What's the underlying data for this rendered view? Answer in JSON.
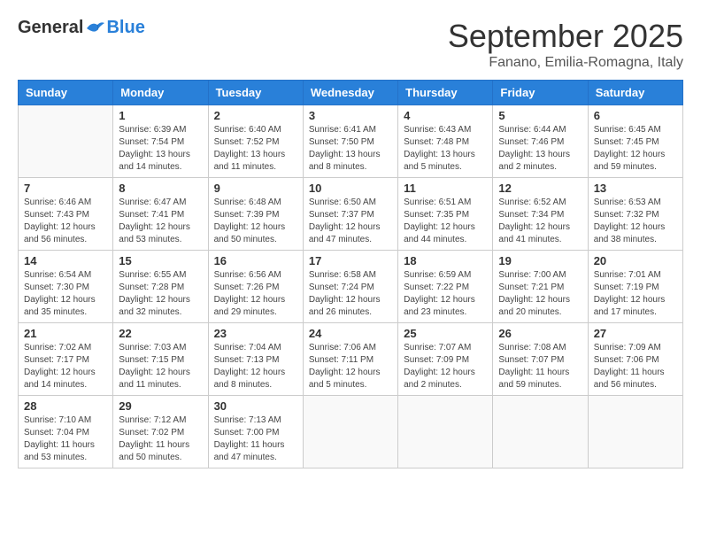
{
  "header": {
    "logo_general": "General",
    "logo_blue": "Blue",
    "month_title": "September 2025",
    "location": "Fanano, Emilia-Romagna, Italy"
  },
  "days_of_week": [
    "Sunday",
    "Monday",
    "Tuesday",
    "Wednesday",
    "Thursday",
    "Friday",
    "Saturday"
  ],
  "weeks": [
    [
      {
        "day": "",
        "info": ""
      },
      {
        "day": "1",
        "info": "Sunrise: 6:39 AM\nSunset: 7:54 PM\nDaylight: 13 hours\nand 14 minutes."
      },
      {
        "day": "2",
        "info": "Sunrise: 6:40 AM\nSunset: 7:52 PM\nDaylight: 13 hours\nand 11 minutes."
      },
      {
        "day": "3",
        "info": "Sunrise: 6:41 AM\nSunset: 7:50 PM\nDaylight: 13 hours\nand 8 minutes."
      },
      {
        "day": "4",
        "info": "Sunrise: 6:43 AM\nSunset: 7:48 PM\nDaylight: 13 hours\nand 5 minutes."
      },
      {
        "day": "5",
        "info": "Sunrise: 6:44 AM\nSunset: 7:46 PM\nDaylight: 13 hours\nand 2 minutes."
      },
      {
        "day": "6",
        "info": "Sunrise: 6:45 AM\nSunset: 7:45 PM\nDaylight: 12 hours\nand 59 minutes."
      }
    ],
    [
      {
        "day": "7",
        "info": "Sunrise: 6:46 AM\nSunset: 7:43 PM\nDaylight: 12 hours\nand 56 minutes."
      },
      {
        "day": "8",
        "info": "Sunrise: 6:47 AM\nSunset: 7:41 PM\nDaylight: 12 hours\nand 53 minutes."
      },
      {
        "day": "9",
        "info": "Sunrise: 6:48 AM\nSunset: 7:39 PM\nDaylight: 12 hours\nand 50 minutes."
      },
      {
        "day": "10",
        "info": "Sunrise: 6:50 AM\nSunset: 7:37 PM\nDaylight: 12 hours\nand 47 minutes."
      },
      {
        "day": "11",
        "info": "Sunrise: 6:51 AM\nSunset: 7:35 PM\nDaylight: 12 hours\nand 44 minutes."
      },
      {
        "day": "12",
        "info": "Sunrise: 6:52 AM\nSunset: 7:34 PM\nDaylight: 12 hours\nand 41 minutes."
      },
      {
        "day": "13",
        "info": "Sunrise: 6:53 AM\nSunset: 7:32 PM\nDaylight: 12 hours\nand 38 minutes."
      }
    ],
    [
      {
        "day": "14",
        "info": "Sunrise: 6:54 AM\nSunset: 7:30 PM\nDaylight: 12 hours\nand 35 minutes."
      },
      {
        "day": "15",
        "info": "Sunrise: 6:55 AM\nSunset: 7:28 PM\nDaylight: 12 hours\nand 32 minutes."
      },
      {
        "day": "16",
        "info": "Sunrise: 6:56 AM\nSunset: 7:26 PM\nDaylight: 12 hours\nand 29 minutes."
      },
      {
        "day": "17",
        "info": "Sunrise: 6:58 AM\nSunset: 7:24 PM\nDaylight: 12 hours\nand 26 minutes."
      },
      {
        "day": "18",
        "info": "Sunrise: 6:59 AM\nSunset: 7:22 PM\nDaylight: 12 hours\nand 23 minutes."
      },
      {
        "day": "19",
        "info": "Sunrise: 7:00 AM\nSunset: 7:21 PM\nDaylight: 12 hours\nand 20 minutes."
      },
      {
        "day": "20",
        "info": "Sunrise: 7:01 AM\nSunset: 7:19 PM\nDaylight: 12 hours\nand 17 minutes."
      }
    ],
    [
      {
        "day": "21",
        "info": "Sunrise: 7:02 AM\nSunset: 7:17 PM\nDaylight: 12 hours\nand 14 minutes."
      },
      {
        "day": "22",
        "info": "Sunrise: 7:03 AM\nSunset: 7:15 PM\nDaylight: 12 hours\nand 11 minutes."
      },
      {
        "day": "23",
        "info": "Sunrise: 7:04 AM\nSunset: 7:13 PM\nDaylight: 12 hours\nand 8 minutes."
      },
      {
        "day": "24",
        "info": "Sunrise: 7:06 AM\nSunset: 7:11 PM\nDaylight: 12 hours\nand 5 minutes."
      },
      {
        "day": "25",
        "info": "Sunrise: 7:07 AM\nSunset: 7:09 PM\nDaylight: 12 hours\nand 2 minutes."
      },
      {
        "day": "26",
        "info": "Sunrise: 7:08 AM\nSunset: 7:07 PM\nDaylight: 11 hours\nand 59 minutes."
      },
      {
        "day": "27",
        "info": "Sunrise: 7:09 AM\nSunset: 7:06 PM\nDaylight: 11 hours\nand 56 minutes."
      }
    ],
    [
      {
        "day": "28",
        "info": "Sunrise: 7:10 AM\nSunset: 7:04 PM\nDaylight: 11 hours\nand 53 minutes."
      },
      {
        "day": "29",
        "info": "Sunrise: 7:12 AM\nSunset: 7:02 PM\nDaylight: 11 hours\nand 50 minutes."
      },
      {
        "day": "30",
        "info": "Sunrise: 7:13 AM\nSunset: 7:00 PM\nDaylight: 11 hours\nand 47 minutes."
      },
      {
        "day": "",
        "info": ""
      },
      {
        "day": "",
        "info": ""
      },
      {
        "day": "",
        "info": ""
      },
      {
        "day": "",
        "info": ""
      }
    ]
  ]
}
